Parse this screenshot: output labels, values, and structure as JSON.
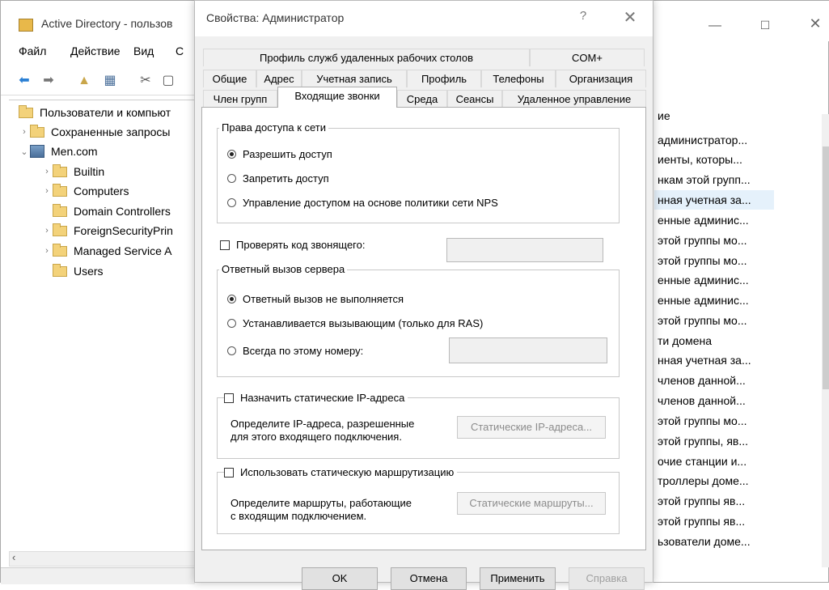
{
  "bg_window": {
    "title": "Active Directory - пользов",
    "controls": {
      "minimize": "—",
      "maximize": "☐",
      "close": "✕"
    },
    "menu": [
      "Файл",
      "Действие",
      "Вид",
      "С"
    ],
    "tree": {
      "root": "Пользователи и компьют",
      "saved_queries": "Сохраненные запросы",
      "domain": "Men.com",
      "children": [
        "Builtin",
        "Computers",
        "Domain Controllers",
        "ForeignSecurityPrin",
        "Managed Service A",
        "Users"
      ]
    },
    "list": {
      "header": "ие",
      "rows": [
        "администратор...",
        "иенты, которы...",
        "нкам этой групп...",
        "нная учетная за...",
        "енные админис...",
        "этой группы мо...",
        "этой группы мо...",
        "енные админис...",
        "енные админис...",
        "этой группы мо...",
        "ти домена",
        "нная учетная за...",
        "членов данной...",
        "членов данной...",
        "этой группы мо...",
        "этой группы, яв...",
        "очие станции и...",
        "троллеры доме...",
        "этой группы яв...",
        "этой группы яв...",
        "ьзователи доме..."
      ]
    }
  },
  "dialog": {
    "title": "Свойства: Администратор",
    "help": "?",
    "close": "✕",
    "tabs_row1": [
      "Профиль служб удаленных рабочих столов",
      "COM+"
    ],
    "tabs_row2": [
      "Общие",
      "Адрес",
      "Учетная запись",
      "Профиль",
      "Телефоны",
      "Организация"
    ],
    "tabs_row3": [
      "Член групп",
      "Входящие звонки",
      "Среда",
      "Сеансы",
      "Удаленное управление"
    ],
    "network_access": {
      "label": "Права доступа к сети",
      "options": [
        "Разрешить доступ",
        "Запретить доступ",
        "Управление доступом на основе политики сети NPS"
      ]
    },
    "verify_caller_id": "Проверять код звонящего:",
    "callback": {
      "label": "Ответный вызов сервера",
      "options": [
        "Ответный вызов не выполняется",
        "Устанавливается вызывающим (только для RAS)",
        "Всегда по этому номеру:"
      ]
    },
    "static_ip": {
      "label": "Назначить статические IP-адреса",
      "desc1": "Определите IP-адреса, разрешенные",
      "desc2": "для этого входящего подключения.",
      "button": "Статические IP-адреса..."
    },
    "static_routes": {
      "label": "Использовать статическую маршрутизацию",
      "desc1": "Определите маршруты, работающие",
      "desc2": "с входящим подключением.",
      "button": "Статические маршруты..."
    },
    "buttons": {
      "ok": "OK",
      "cancel": "Отмена",
      "apply": "Применить",
      "help": "Справка"
    }
  }
}
